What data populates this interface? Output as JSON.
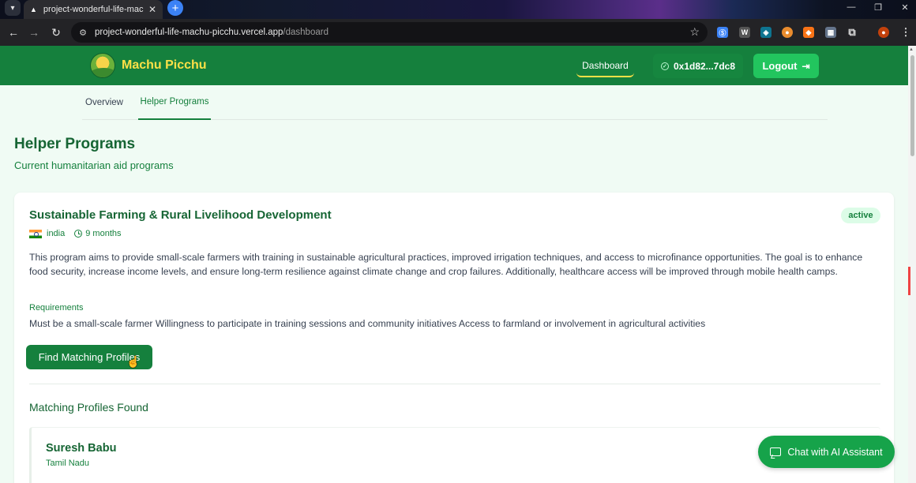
{
  "browser": {
    "tab_title": "project-wonderful-life-machu-p",
    "url_host": "project-wonderful-life-machu-picchu.vercel.app",
    "url_path": "/dashboard"
  },
  "header": {
    "brand": "Machu Picchu",
    "nav_dashboard": "Dashboard",
    "wallet": "0x1d82...7dc8",
    "logout": "Logout"
  },
  "tabs": [
    {
      "label": "Overview",
      "active": false
    },
    {
      "label": "Helper Programs",
      "active": true
    }
  ],
  "page": {
    "title": "Helper Programs",
    "subtitle": "Current humanitarian aid programs"
  },
  "program": {
    "title": "Sustainable Farming & Rural Livelihood Development",
    "status": "active",
    "country": "india",
    "duration": "9 months",
    "description": "This program aims to provide small-scale farmers with training in sustainable agricultural practices, improved irrigation techniques, and access to microfinance opportunities. The goal is to enhance food security, increase income levels, and ensure long-term resilience against climate change and crop failures. Additionally, healthcare access will be improved through mobile health camps.",
    "requirements_label": "Requirements",
    "requirements": "Must be a small-scale farmer Willingness to participate in training sessions and community initiatives Access to farmland or involvement in agricultural activities",
    "find_button": "Find Matching Profiles"
  },
  "matches": {
    "title": "Matching Profiles Found",
    "profiles": [
      {
        "name": "Suresh Babu",
        "location": "Tamil Nadu"
      }
    ]
  },
  "chat": {
    "label": "Chat with AI Assistant"
  },
  "colors": {
    "primary": "#15803d",
    "brand_yellow": "#fde047",
    "badge_bg": "#dcfce7",
    "page_bg": "#f0fbf4"
  }
}
